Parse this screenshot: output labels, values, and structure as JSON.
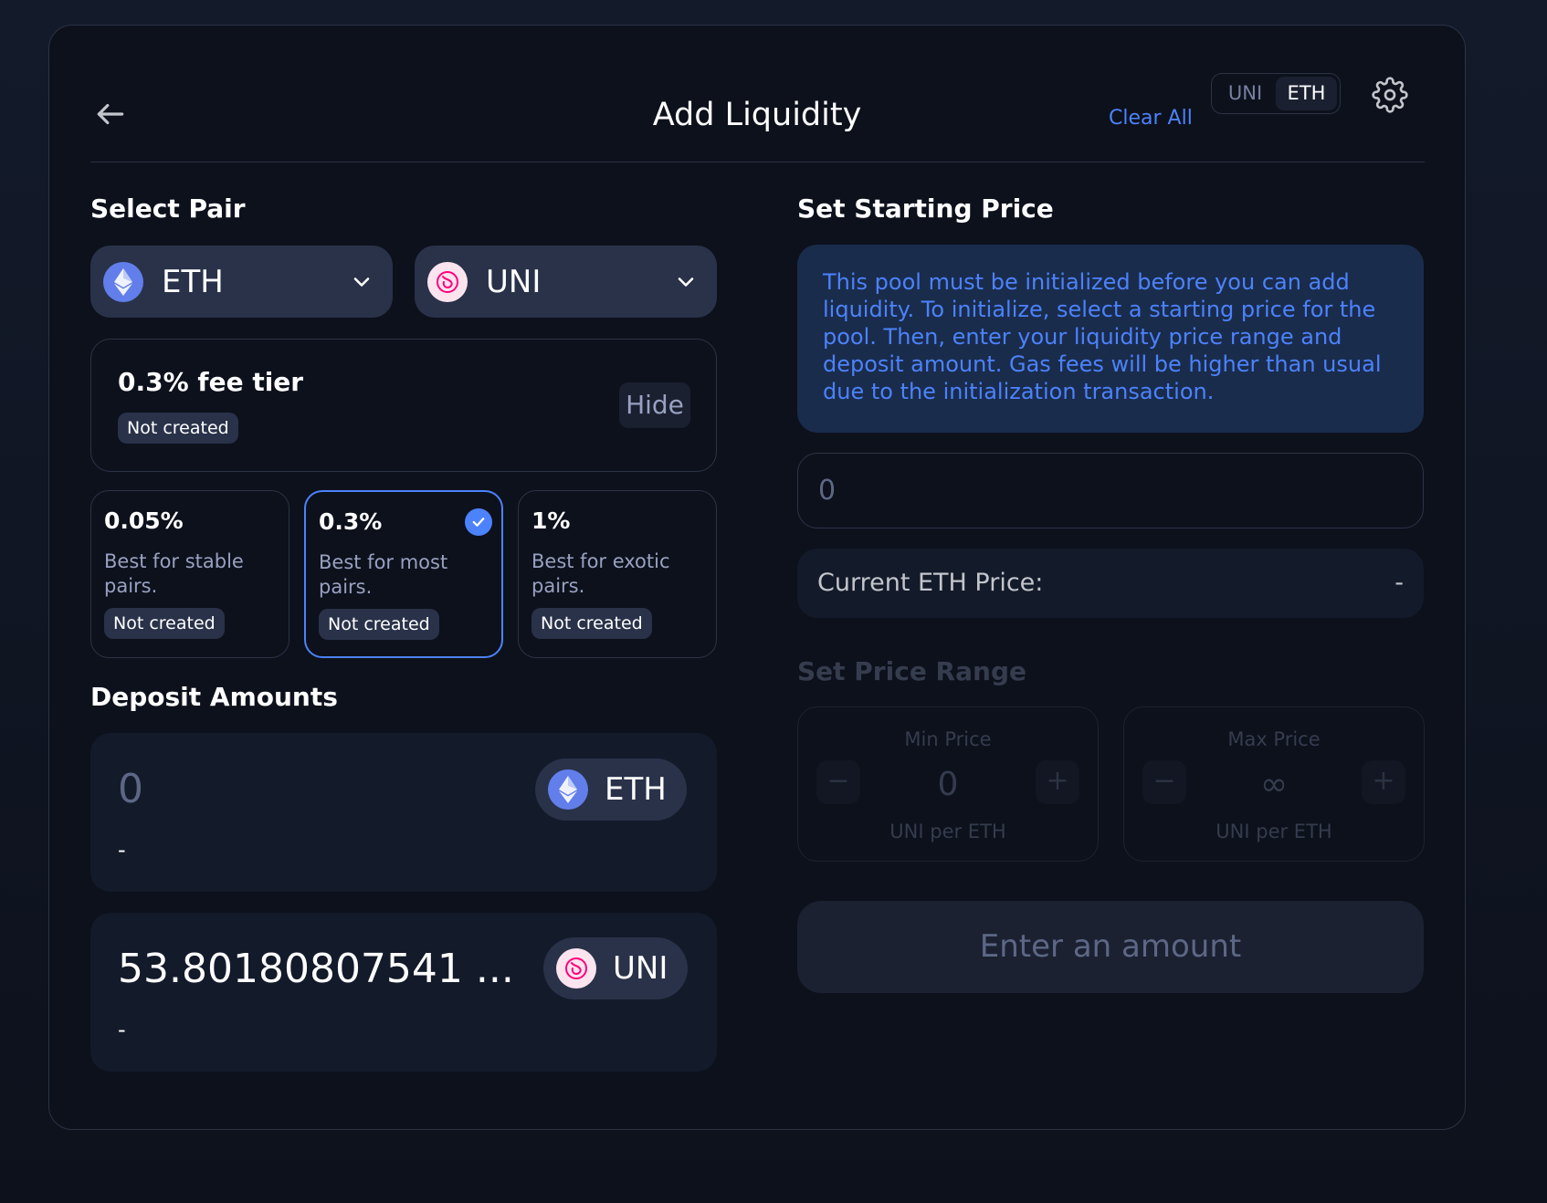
{
  "header": {
    "title": "Add Liquidity",
    "clear_all": "Clear All",
    "toggle": [
      "UNI",
      "ETH"
    ],
    "toggle_active": "ETH"
  },
  "select_pair": {
    "title": "Select Pair",
    "token_a": {
      "symbol": "ETH",
      "icon": "eth-logo-icon"
    },
    "token_b": {
      "symbol": "UNI",
      "icon": "uni-logo-icon"
    }
  },
  "fee_summary": {
    "tier": "0.3% fee tier",
    "status": "Not created",
    "hide_label": "Hide"
  },
  "fee_options": [
    {
      "pct": "0.05%",
      "desc": "Best for stable pairs.",
      "status": "Not created",
      "selected": false
    },
    {
      "pct": "0.3%",
      "desc": "Best for most pairs.",
      "status": "Not created",
      "selected": true
    },
    {
      "pct": "1%",
      "desc": "Best for exotic pairs.",
      "status": "Not created",
      "selected": false
    }
  ],
  "deposit": {
    "title": "Deposit Amounts",
    "input_a": {
      "value": "0",
      "symbol": "ETH",
      "usd": "-"
    },
    "input_b": {
      "value": "53.80180807541 ...",
      "symbol": "UNI",
      "usd": "-"
    }
  },
  "starting_price": {
    "title": "Set Starting Price",
    "info": "This pool must be initialized before you can add liquidity. To initialize, select a starting price for the pool. Then, enter your liquidity price range and deposit amount. Gas fees will be higher than usual due to the initialization transaction.",
    "input_placeholder": "0",
    "current_label": "Current ETH Price:",
    "current_value": "-"
  },
  "price_range": {
    "title": "Set Price Range",
    "min": {
      "label": "Min Price",
      "value": "0",
      "unit": "UNI per ETH"
    },
    "max": {
      "label": "Max Price",
      "value": "∞",
      "unit": "UNI per ETH"
    },
    "minus": "−",
    "plus": "+"
  },
  "submit": {
    "label": "Enter an amount"
  },
  "colors": {
    "accent": "#4c82fb",
    "card_bg": "#0d111c",
    "surface": "#293249"
  }
}
